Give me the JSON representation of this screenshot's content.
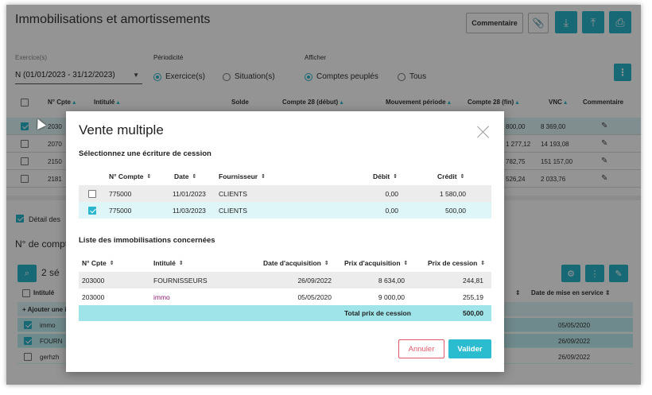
{
  "app": {
    "title": "Immobilisations et amortissements"
  },
  "toolbar": {
    "comment_label": "Commentaire"
  },
  "filters": {
    "exercice_label": "Exercice(s)",
    "exercice_value": "N (01/01/2023 - 31/12/2023)",
    "periodicite_label": "Périodicité",
    "periodicite_options": [
      "Exercice(s)",
      "Situation(s)"
    ],
    "afficher_label": "Afficher",
    "afficher_options": [
      "Comptes peuplés",
      "Tous"
    ]
  },
  "main_table": {
    "headers": [
      "N° Cpte",
      "Intitulé",
      "Solde",
      "Compte 28 (début)",
      "Mouvement période",
      "Compte 28 (fin)",
      "VNC",
      "Commentaire"
    ],
    "rows": [
      {
        "num": "2030",
        "c28fin": "800,00",
        "vnc": "8 369,00",
        "checked": true
      },
      {
        "num": "2070",
        "c28fin": "1 277,12",
        "vnc": "14 193,08",
        "checked": false
      },
      {
        "num": "2150",
        "c28fin": "782,75",
        "vnc": "151 157,00",
        "checked": false
      },
      {
        "num": "2181",
        "c28fin": "526,24",
        "vnc": "2 033,76",
        "checked": false
      }
    ]
  },
  "lower": {
    "detail_label": "Détail des",
    "num_compte_label": "N° de compt",
    "count_label": "2 sé",
    "header_intitule": "Intitulé",
    "header_mise_service": "Date de mise en service",
    "add_label": "+ Ajouter une i",
    "rows": [
      {
        "name": "immo",
        "date": "05/05/2020",
        "checked": true
      },
      {
        "name": "FOURN",
        "date": "26/09/2022",
        "checked": true
      },
      {
        "name": "gerhzh",
        "date": "26/09/2022",
        "checked": false
      }
    ]
  },
  "modal": {
    "title": "Vente multiple",
    "section1": "Sélectionnez une écriture de cession",
    "cession_headers": [
      "N° Compte",
      "Date",
      "Fournisseur",
      "Débit",
      "Crédit"
    ],
    "cession_rows": [
      {
        "compte": "775000",
        "date": "11/01/2023",
        "fournisseur": "CLIENTS",
        "debit": "0,00",
        "credit": "1 580,00",
        "checked": false
      },
      {
        "compte": "775000",
        "date": "11/03/2023",
        "fournisseur": "CLIENTS",
        "debit": "0,00",
        "credit": "500,00",
        "checked": true
      }
    ],
    "section2": "Liste des immobilisations concernées",
    "immo_headers": [
      "N° Cpte",
      "Intitulé",
      "Date d'acquisition",
      "Prix d'acquisition",
      "Prix de cession"
    ],
    "immo_rows": [
      {
        "cpte": "203000",
        "intitule": "FOURNISSEURS",
        "date_acq": "26/09/2022",
        "prix_acq": "8 634,00",
        "prix_cession": "244,81"
      },
      {
        "cpte": "203000",
        "intitule": "immo",
        "date_acq": "05/05/2020",
        "prix_acq": "9 000,00",
        "prix_cession": "255,19"
      }
    ],
    "total_label": "Total prix de cession",
    "total_value": "500,00",
    "cancel_label": "Annuler",
    "validate_label": "Valider"
  }
}
